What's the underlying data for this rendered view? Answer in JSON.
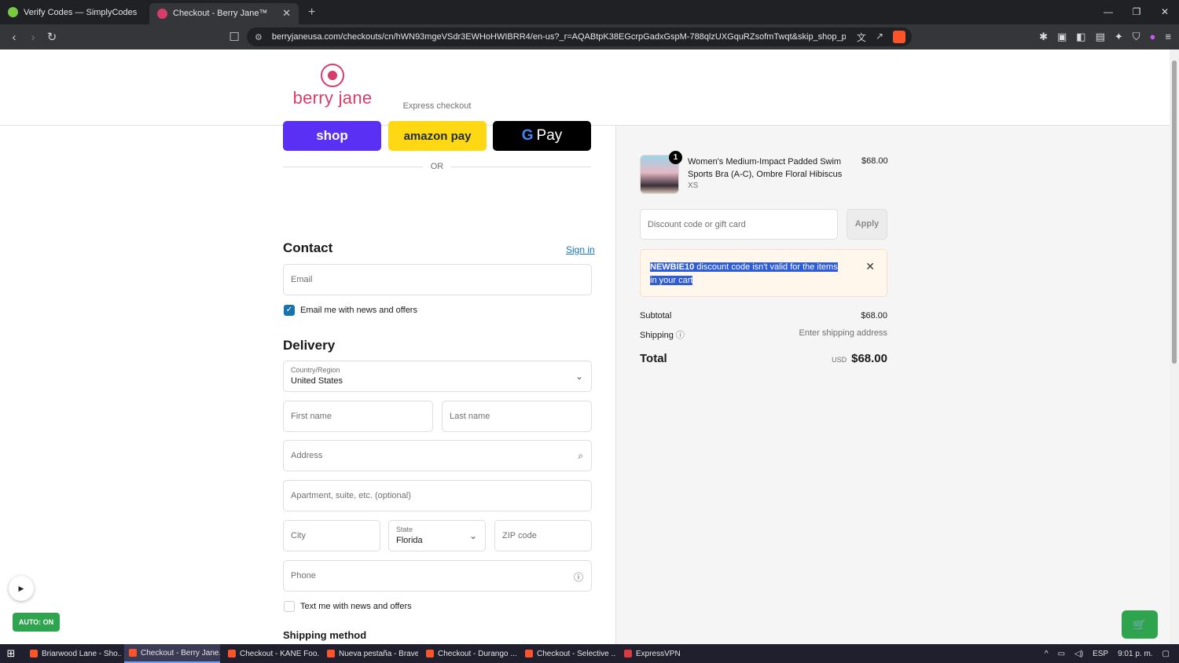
{
  "browser": {
    "tabs": [
      {
        "label": "Verify Codes — SimplyCodes",
        "active": false
      },
      {
        "label": "Checkout - Berry Jane™",
        "active": true
      }
    ],
    "url": "berryjaneusa.com/checkouts/cn/hWN93mgeVSdr3EWHoHWIBRR4/en-us?_r=AQABtpK38EGcrpGadxGspM-788qlzUXGquRZsofmTwqt&skip_shop_pay..."
  },
  "header": {
    "logo_text": "berry jane"
  },
  "express": {
    "label": "Express checkout",
    "shop_label": "shop",
    "amazon_label": "amazon pay",
    "gpay_g": "G",
    "gpay_label": "Pay",
    "or_label": "OR"
  },
  "contact": {
    "title": "Contact",
    "sign_in": "Sign in",
    "email_placeholder": "Email",
    "news_label": "Email me with news and offers"
  },
  "delivery": {
    "title": "Delivery",
    "country_label": "Country/Region",
    "country_value": "United States",
    "first_name": "First name",
    "last_name": "Last name",
    "address": "Address",
    "apartment": "Apartment, suite, etc. (optional)",
    "city": "City",
    "state_label": "State",
    "state_value": "Florida",
    "zip": "ZIP code",
    "phone": "Phone",
    "text_label": "Text me with news and offers",
    "shipping_method": "Shipping method"
  },
  "order": {
    "qty": "1",
    "product_name": "Women's Medium-Impact Padded Swim Sports Bra (A-C), Ombre Floral Hibiscus",
    "variant": "XS",
    "price": "$68.00",
    "discount_placeholder": "Discount code or gift card",
    "apply": "Apply",
    "alert_code": "NEWBIE10",
    "alert_text": " discount code isn't valid for the items in your cart",
    "subtotal_label": "Subtotal",
    "subtotal_value": "$68.00",
    "shipping_label": "Shipping",
    "shipping_value": "Enter shipping address",
    "total_label": "Total",
    "total_currency": "USD",
    "total_value": "$68.00"
  },
  "overlay": {
    "auto_label": "AUTO: ON"
  },
  "taskbar": {
    "items": [
      "Briarwood Lane - Sho...",
      "Checkout - Berry Jane...",
      "Checkout - KANE Foo...",
      "Nueva pestaña - Brave",
      "Checkout - Durango ...",
      "Checkout - Selective ...",
      "ExpressVPN"
    ],
    "lang": "ESP",
    "time": "9:01 p. m."
  }
}
